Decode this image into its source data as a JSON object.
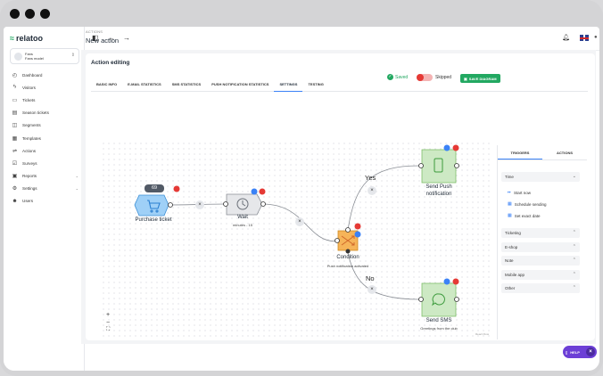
{
  "app": {
    "brand": "relatoo"
  },
  "workspace": {
    "line1": "Fans",
    "line2": "Fans model"
  },
  "sidebar": {
    "items": [
      {
        "icon": "dashboard-icon",
        "glyph": "◴",
        "label": "Dashboard"
      },
      {
        "icon": "visitors-icon",
        "glyph": "ϟ",
        "label": "Visitors"
      },
      {
        "icon": "tickets-icon",
        "glyph": "▭",
        "label": "Tickets"
      },
      {
        "icon": "season-tickets-icon",
        "glyph": "▤",
        "label": "Season tickets"
      },
      {
        "icon": "segments-icon",
        "glyph": "◫",
        "label": "Segments"
      },
      {
        "icon": "templates-icon",
        "glyph": "▦",
        "label": "Templates"
      },
      {
        "icon": "actions-icon",
        "glyph": "⇌",
        "label": "Actions"
      },
      {
        "icon": "surveys-icon",
        "glyph": "☑",
        "label": "Surveys"
      },
      {
        "icon": "reports-icon",
        "glyph": "▣",
        "label": "Reports",
        "caret": "⌄"
      },
      {
        "icon": "settings-icon",
        "glyph": "⚙",
        "label": "Settings",
        "caret": "⌄"
      },
      {
        "icon": "users-icon",
        "glyph": "☻",
        "label": "Users"
      }
    ]
  },
  "header": {
    "breadcrumb": "ACTIONS",
    "title": "New action"
  },
  "card": {
    "title": "Action editing"
  },
  "tabs": [
    "BASIC INFO",
    "E-MAIL STATISTICS",
    "SMS STATISTICS",
    "PUSH NOTIFICATION STATISTICS",
    "SETTINGS",
    "TESTING"
  ],
  "status": {
    "saved": "Saved",
    "skipped": "Skipped",
    "save_button": "SAVE DIAGRAM"
  },
  "diagram": {
    "purchase": {
      "label": "Purchase ticket",
      "count": "69"
    },
    "wait": {
      "label": "Wait",
      "sub": "minutes - 15"
    },
    "condition": {
      "label": "Condition",
      "sub": "Push notification activated"
    },
    "push": {
      "label1": "Send Push",
      "label2": "notification"
    },
    "sms": {
      "label": "Send SMS",
      "sub": "Greetings from the club"
    },
    "yes": "Yes",
    "no": "No",
    "close_glyph": "×",
    "zoom_in": "+",
    "zoom_out": "−",
    "fit": "⛶",
    "attribution": "React Flow"
  },
  "panel": {
    "tabs": [
      "TRIGGERS",
      "ACTIONS"
    ],
    "time": "Time",
    "options": [
      "Start now",
      "Schedule sending",
      "Set exact date"
    ],
    "sections": [
      "Ticketing",
      "E-shop",
      "Note",
      "Mobile app",
      "Other"
    ]
  },
  "help": {
    "label": "HELP"
  },
  "colors": {
    "accent": "#3b82f6",
    "brand": "#22a861",
    "purchase": "#9fd0f7",
    "condition": "#f6b459",
    "action": "#cde9c4",
    "danger": "#e53935"
  }
}
